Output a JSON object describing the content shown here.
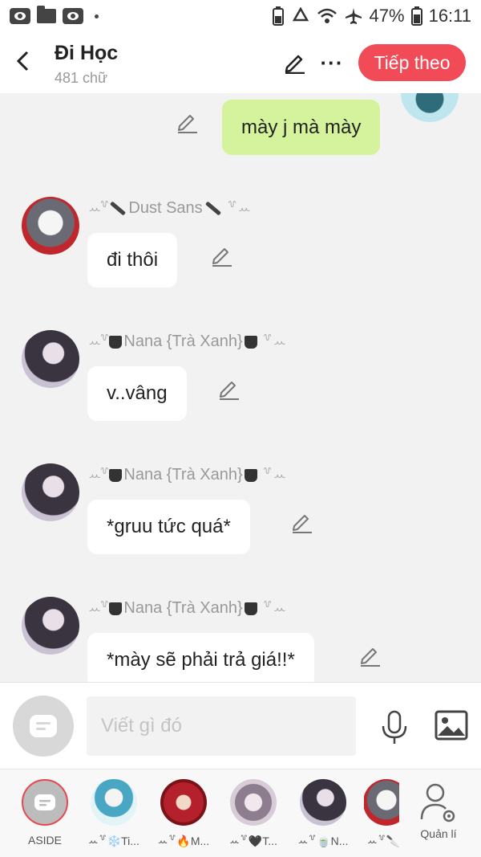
{
  "status_bar": {
    "battery_percent": "47%",
    "time": "16:11"
  },
  "header": {
    "title": "Đi Học",
    "subtitle": "481 chữ",
    "next_label": "Tiếp theo",
    "more_label": "···"
  },
  "messages": [
    {
      "sender": "",
      "text": "mày j mà mày",
      "mine": true
    },
    {
      "sender": "Dust Sans",
      "text": "đi thôi",
      "mine": false
    },
    {
      "sender": "Nana {Trà Xanh}",
      "text": "v..vâng",
      "mine": false
    },
    {
      "sender": "Nana {Trà Xanh}",
      "text": "*gruu tức quá*",
      "mine": false
    },
    {
      "sender": "Nana {Trà Xanh}",
      "text": "*mày sẽ phải trả giá!!*",
      "mine": false
    }
  ],
  "input": {
    "placeholder": "Viết gì đó"
  },
  "bottom_tabs": [
    {
      "label": "ASIDE"
    },
    {
      "label": "ꕀ꒷❄️Ti..."
    },
    {
      "label": "ꕀ꒷🔥M..."
    },
    {
      "label": "ꕀ꒷🖤T..."
    },
    {
      "label": "ꕀ꒷🍵N..."
    },
    {
      "label": "ꕀ꒷🔪"
    },
    {
      "label": "Quản lí"
    }
  ],
  "colors": {
    "accent": "#f04b56",
    "my_bubble": "#d4f39c",
    "other_bubble": "#ffffff",
    "chat_background": "#f2f2f2"
  }
}
